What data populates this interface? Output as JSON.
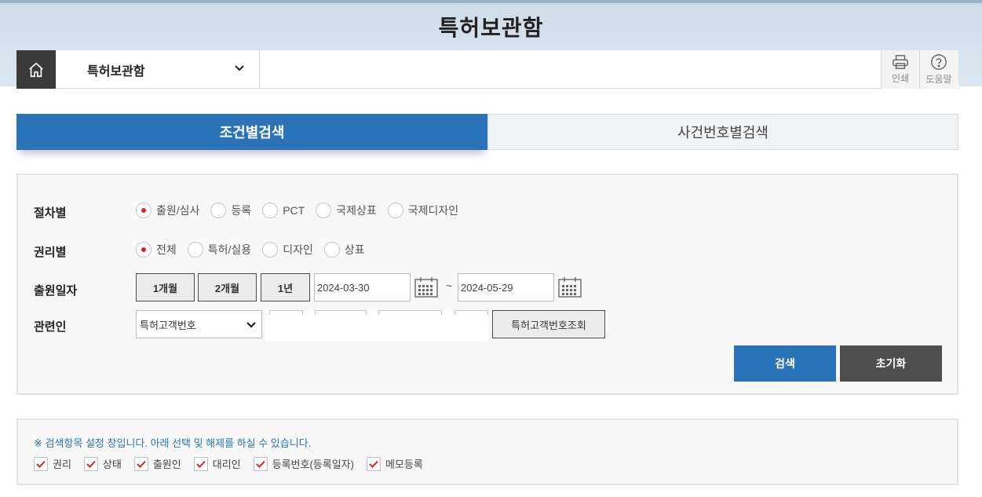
{
  "page_title": "특허보관함",
  "nav": {
    "menu_label": "특허보관함",
    "print_label": "인쇄",
    "help_label": "도움말"
  },
  "tabs": [
    {
      "label": "조건별검색",
      "active": true
    },
    {
      "label": "사건번호별검색",
      "active": false
    }
  ],
  "search": {
    "procedure": {
      "label": "절차별",
      "options": [
        "출원/심사",
        "등록",
        "PCT",
        "국제상표",
        "국제디자인"
      ],
      "selected": "출원/심사"
    },
    "right": {
      "label": "권리별",
      "options": [
        "전체",
        "특허/실용",
        "디자인",
        "상표"
      ],
      "selected": "전체"
    },
    "date": {
      "label": "출원일자",
      "period_buttons": [
        "1개월",
        "2개월",
        "1년"
      ],
      "from": "2024-03-30",
      "separator": "~",
      "to": "2024-05-29"
    },
    "related": {
      "label": "관련인",
      "select_value": "특허고객번호",
      "lookup_label": "특허고객번호조회"
    },
    "search_label": "검색",
    "reset_label": "초기화"
  },
  "items": {
    "notice": "※ 검색항목 설정 창입니다. 아래 선택 및 해제를 하실 수 있습니다.",
    "checkboxes": [
      {
        "label": "권리",
        "checked": true
      },
      {
        "label": "상태",
        "checked": true
      },
      {
        "label": "출원인",
        "checked": true
      },
      {
        "label": "대리인",
        "checked": true
      },
      {
        "label": "등록번호(등록일자)",
        "checked": true
      },
      {
        "label": "메모등록",
        "checked": true
      }
    ]
  },
  "colors": {
    "accent": "#2b73b8",
    "radio_selected": "#d0262d",
    "check_mark": "#d0262d",
    "reset_button": "#4d4d4d"
  }
}
